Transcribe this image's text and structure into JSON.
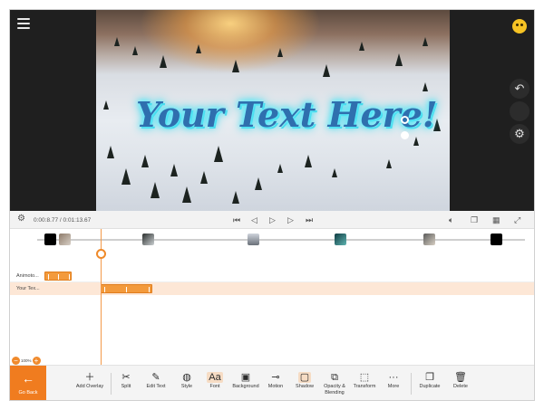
{
  "preview": {
    "overlay_text": "Your Text Here!",
    "side_icons": [
      "undo-icon",
      "blank-icon",
      "gear-icon"
    ]
  },
  "transport": {
    "time": "0:00:8.77 / 0:01:13.67"
  },
  "timeline": {
    "tracks": [
      {
        "label": "Animoto...",
        "clip_start": 0.07,
        "clip_end": 0.13
      },
      {
        "label": "Your Tex...",
        "clip_start": 0.18,
        "clip_end": 0.28
      }
    ],
    "zoom": "100%"
  },
  "toolbar": {
    "go_back": "Go Back",
    "items": [
      {
        "label": "Add Overlay",
        "icon": "plus-icon"
      },
      {
        "label": "Split",
        "icon": "scissors-icon"
      },
      {
        "label": "Edit Text",
        "icon": "pencil-icon"
      },
      {
        "label": "Style",
        "icon": "palette-icon"
      },
      {
        "label": "Font",
        "icon": "font-icon"
      },
      {
        "label": "Background",
        "icon": "text-box-icon"
      },
      {
        "label": "Motion",
        "icon": "motion-icon"
      },
      {
        "label": "Shadow",
        "icon": "shadow-icon"
      },
      {
        "label": "Opacity & Blending",
        "icon": "blend-icon"
      },
      {
        "label": "Transform",
        "icon": "transform-icon"
      },
      {
        "label": "More",
        "icon": "more-icon"
      },
      {
        "label": "Duplicate",
        "icon": "duplicate-icon"
      },
      {
        "label": "Delete",
        "icon": "trash-icon"
      }
    ]
  },
  "colors": {
    "accent": "#f07c1f",
    "clip": "#f39a3c",
    "text_glow": "#3ee5f5",
    "text_fill": "#2f6fae"
  }
}
